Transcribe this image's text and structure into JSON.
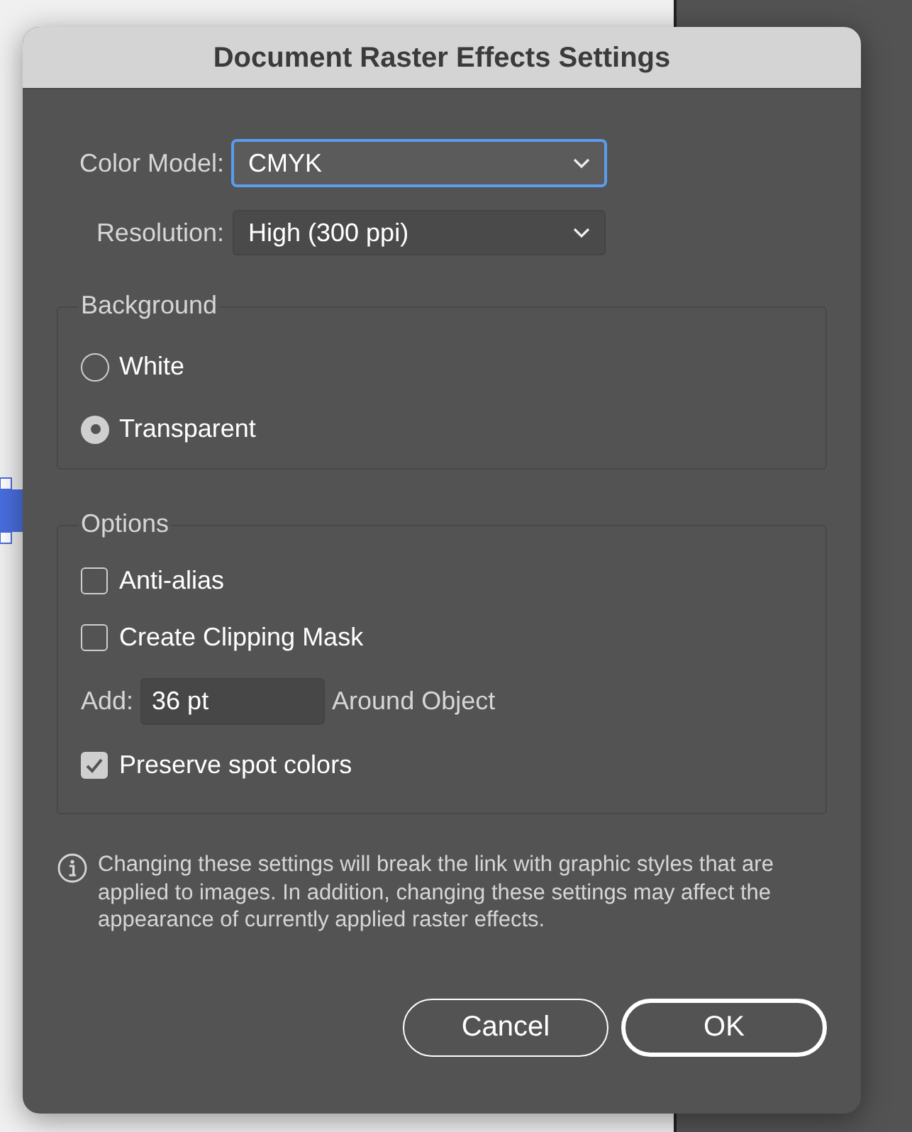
{
  "window": {
    "title": "Document Raster Effects Settings"
  },
  "fields": [
    {
      "label": "Color Model:",
      "value": "CMYK",
      "focused": true
    },
    {
      "label": "Resolution:",
      "value": "High (300 ppi)",
      "focused": false
    }
  ],
  "background": {
    "title": "Background",
    "options": [
      {
        "label": "White",
        "selected": false
      },
      {
        "label": "Transparent",
        "selected": true
      }
    ]
  },
  "options": {
    "title": "Options",
    "items": [
      {
        "kind": "checkbox",
        "label": "Anti-alias",
        "checked": false
      },
      {
        "kind": "checkbox",
        "label": "Create Clipping Mask",
        "checked": false
      },
      {
        "kind": "add",
        "label": "Add:",
        "value": "36 pt",
        "suffix": "Around Object"
      },
      {
        "kind": "checkbox",
        "label": "Preserve spot colors",
        "checked": true
      }
    ]
  },
  "note": "Changing these settings will break the link with graphic styles that are applied to images. In addition, changing these settings may affect the appearance of currently applied raster effects.",
  "buttons": [
    {
      "label": "Cancel",
      "default": false
    },
    {
      "label": "OK",
      "default": true
    }
  ]
}
